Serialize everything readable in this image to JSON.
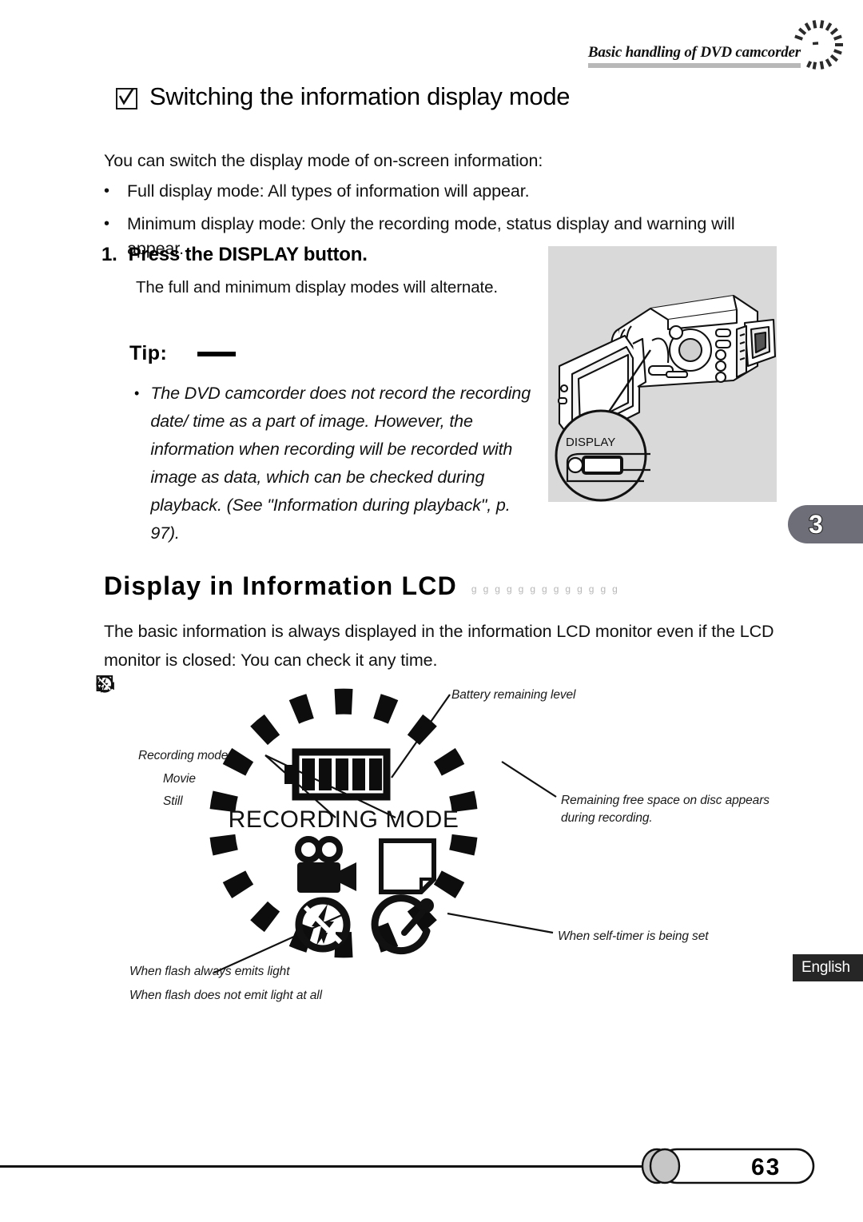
{
  "header": {
    "running_title": "Basic handling of DVD camcorder",
    "arc_icon": "dotted-arc-icon"
  },
  "section": {
    "checkbox_icon": "checkbox-checked-icon",
    "heading": "Switching the information display mode",
    "intro": "You can switch the display mode of on-screen information:",
    "bullets": [
      {
        "marker": "•",
        "text": "Full display mode: All types of information will appear."
      },
      {
        "marker": "•",
        "text": "Minimum display mode: Only the recording mode, status display and warning will appear."
      }
    ]
  },
  "step": {
    "number": "1.",
    "title": "Press the DISPLAY button.",
    "body": "The full and minimum display modes will alternate."
  },
  "tip": {
    "label": "Tip:",
    "marker": "•",
    "text": "The DVD camcorder does not record the recording date/ time as a part of image. However, the information when recording will be recorded with image as data, which can be checked during playback. (See \"Information during playback\", p. 97)."
  },
  "figure": {
    "camcorder_icon": "dvd-camcorder-illustration",
    "callout_label": "DISPLAY"
  },
  "chapter_tab": {
    "number": "3"
  },
  "lcd_section": {
    "heading": "Display in Information LCD",
    "heading_decoration": [
      "g",
      "g",
      "g",
      "g",
      "g",
      "g",
      "g",
      "g",
      "g",
      "g",
      "g",
      "g",
      "g"
    ],
    "intro": "The basic information is always displayed in the information LCD monitor even if the LCD monitor is closed: You can check it any time."
  },
  "lcd_diagram": {
    "ring_icon": "segmented-ring-icon",
    "battery_icon": "battery-full-icon",
    "center_text": "RECORDING MODE",
    "movie_icon": "movie-camera-icon",
    "still_icon": "still-photo-icon",
    "flash_off_icon": "flash-off-icon",
    "self_timer_icon": "self-timer-icon",
    "callouts": {
      "battery": "Battery remaining level",
      "free_space": "Remaining free space on disc appears during recording.",
      "self_timer": "When self-timer is being set",
      "recording_mode_title": "Recording mode",
      "movie": "Movie",
      "still": "Still",
      "flash_always": "When flash always emits light",
      "flash_never": "When flash does not emit light at all"
    }
  },
  "language_tab": {
    "label": "English"
  },
  "footer": {
    "page_number": "63"
  }
}
